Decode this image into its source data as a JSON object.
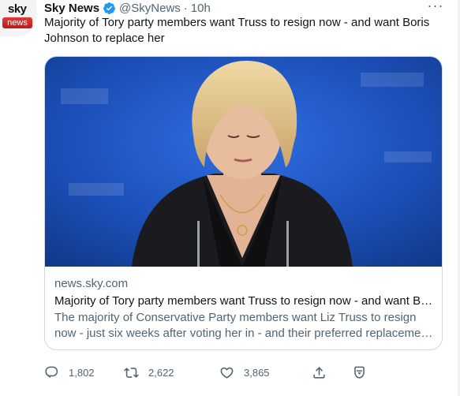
{
  "account": {
    "name": "Sky News",
    "handle": "@SkyNews",
    "separator": "·",
    "time": "10h",
    "avatar_top": "sky",
    "avatar_bottom": "news"
  },
  "tweet": {
    "text": "Majority of Tory party members want Truss to resign now - and want Boris Johnson to replace her"
  },
  "card": {
    "domain": "news.sky.com",
    "title": "Majority of Tory party members want Truss to resign now - and want Boris Johnson to replace her",
    "description": "The majority of Conservative Party members want Liz Truss to resign now - just six weeks after voting her in - and their preferred replacement is Boris Johnson."
  },
  "actions": {
    "replies": "1,802",
    "retweets": "2,622",
    "likes": "3,865"
  },
  "colors": {
    "verified": "#1d9bf0",
    "secondary_text": "#536471",
    "photo_background": "#1c4fb8"
  },
  "icons": [
    "verified-badge-icon",
    "more-icon",
    "reply-icon",
    "retweet-icon",
    "like-icon",
    "share-icon",
    "bookmark-icon"
  ]
}
